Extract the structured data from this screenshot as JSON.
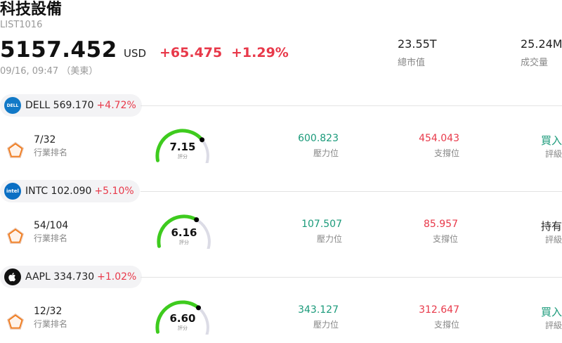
{
  "header": {
    "title": "科技設備",
    "code": "LIST1016",
    "price": "5157.452",
    "currency": "USD",
    "change": "+65.475",
    "change_pct": "+1.29%",
    "time": "09/16, 09:47 （美東）"
  },
  "stats": [
    {
      "value": "23.55T",
      "label": "總市值"
    },
    {
      "value": "25.24M",
      "label": "成交量"
    }
  ],
  "colors": {
    "up": "#e8394a",
    "resistance": "#1a9a7a",
    "buy": "#1a9a7a",
    "gauge_fill": "#3ecb1e",
    "gauge_track": "#dcdce6"
  },
  "stocks": [
    {
      "logo_text": "DELL",
      "logo_icon": "dell-logo-icon",
      "logo_color": "#1279c7",
      "symbol_price": "DELL 569.170",
      "change_pct": "+4.72%",
      "rank": "7/32",
      "rank_label": "行業排名",
      "score": "7.15",
      "score_value": 7.15,
      "score_label": "評分",
      "resistance": "600.823",
      "resistance_label": "壓力位",
      "support": "454.043",
      "support_label": "支撐位",
      "rating": "買入",
      "rating_label": "評級",
      "rating_color": "#1a9a7a"
    },
    {
      "logo_text": "intel",
      "logo_icon": "intel-logo-icon",
      "logo_color": "#0a6fc4",
      "symbol_price": "INTC 102.090",
      "change_pct": "+5.10%",
      "rank": "54/104",
      "rank_label": "行業排名",
      "score": "6.16",
      "score_value": 6.16,
      "score_label": "評分",
      "resistance": "107.507",
      "resistance_label": "壓力位",
      "support": "85.957",
      "support_label": "支撐位",
      "rating": "持有",
      "rating_label": "評級",
      "rating_color": "#222222"
    },
    {
      "logo_text": "",
      "logo_icon": "apple-logo-icon",
      "logo_color": "#111111",
      "symbol_price": "AAPL 334.730",
      "change_pct": "+1.02%",
      "rank": "12/32",
      "rank_label": "行業排名",
      "score": "6.60",
      "score_value": 6.6,
      "score_label": "評分",
      "resistance": "343.127",
      "resistance_label": "壓力位",
      "support": "312.647",
      "support_label": "支撐位",
      "rating": "買入",
      "rating_label": "評級",
      "rating_color": "#1a9a7a"
    }
  ]
}
